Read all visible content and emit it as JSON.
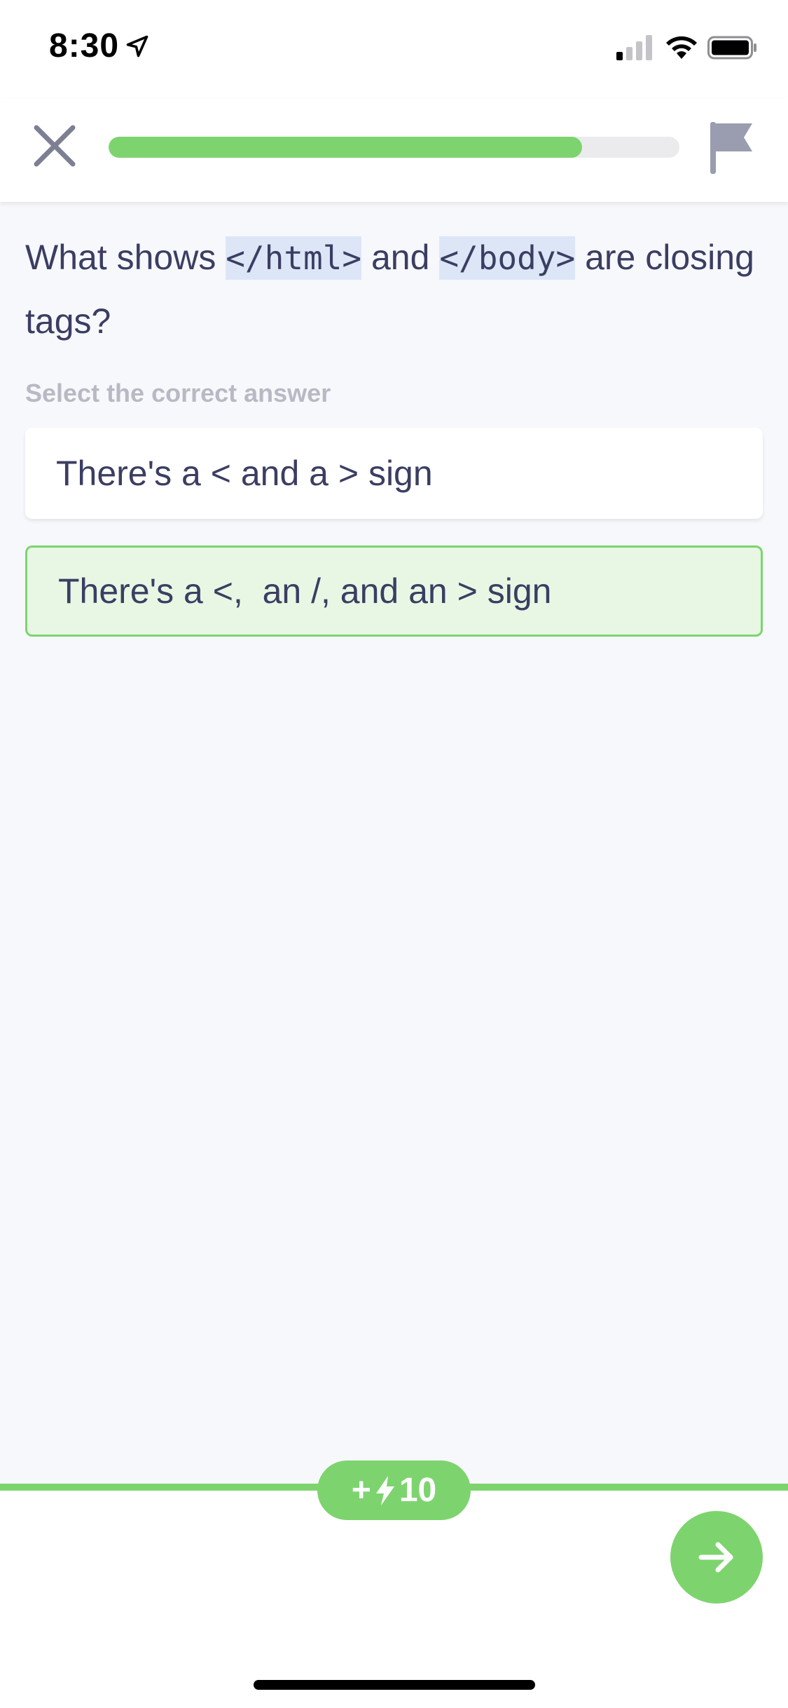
{
  "status_bar": {
    "time": "8:30"
  },
  "header": {
    "progress": 0.83
  },
  "question": {
    "prefix": "What shows ",
    "code_1": "</html>",
    "middle": " and ",
    "code_2": "</body>",
    "suffix": " are closing tags?"
  },
  "instruction": "Select the correct answer",
  "answers": [
    {
      "label": "There's a < and a > sign",
      "selected": false
    },
    {
      "label": "There's a <,  an /, and an > sign",
      "selected": true
    }
  ],
  "reward": {
    "plus": "+",
    "amount": "10"
  },
  "colors": {
    "accent_green": "#7dd46e",
    "selected_bg": "#e7f7e4",
    "text_primary": "#3b3e62",
    "code_highlight": "#dde6f7"
  },
  "icons": {
    "close": "close-icon",
    "flag": "flag-icon",
    "bolt": "bolt-icon",
    "next": "arrow-right-icon"
  }
}
